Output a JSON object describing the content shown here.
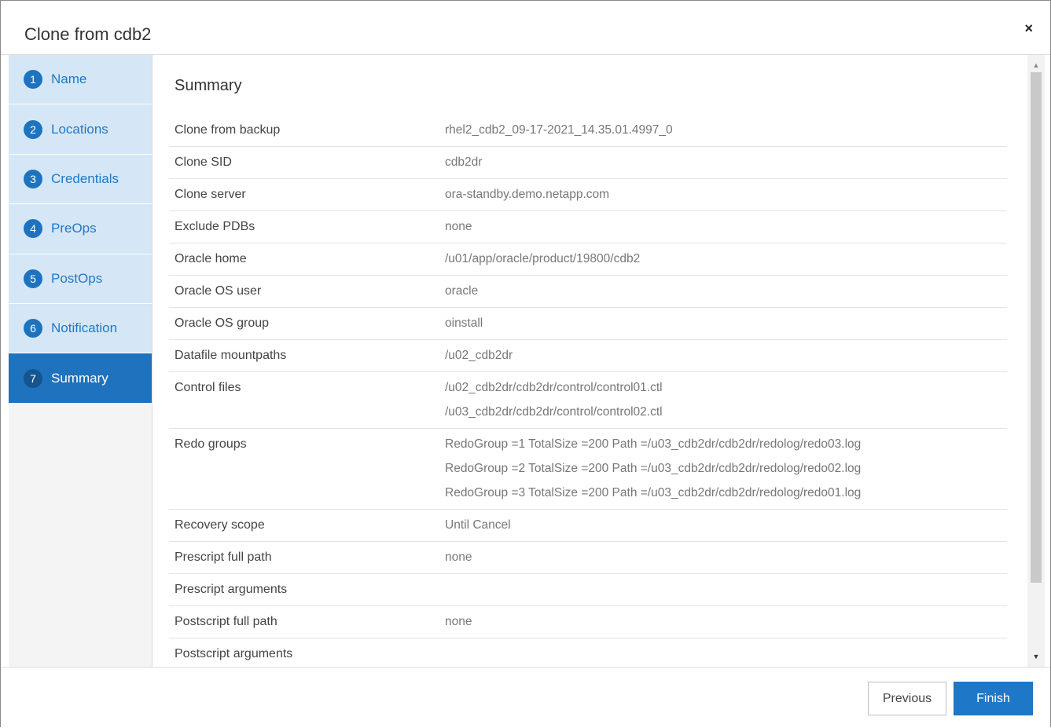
{
  "dialog": {
    "title": "Clone from cdb2",
    "close_label": "×"
  },
  "sidebar": {
    "items": [
      {
        "number": "1",
        "label": "Name"
      },
      {
        "number": "2",
        "label": "Locations"
      },
      {
        "number": "3",
        "label": "Credentials"
      },
      {
        "number": "4",
        "label": "PreOps"
      },
      {
        "number": "5",
        "label": "PostOps"
      },
      {
        "number": "6",
        "label": "Notification"
      },
      {
        "number": "7",
        "label": "Summary"
      }
    ],
    "active_index": 6
  },
  "main": {
    "title": "Summary",
    "rows": [
      {
        "key": "Clone from backup",
        "values": [
          "rhel2_cdb2_09-17-2021_14.35.01.4997_0"
        ]
      },
      {
        "key": "Clone SID",
        "values": [
          "cdb2dr"
        ]
      },
      {
        "key": "Clone server",
        "values": [
          "ora-standby.demo.netapp.com"
        ]
      },
      {
        "key": "Exclude PDBs",
        "values": [
          "none"
        ]
      },
      {
        "key": "Oracle home",
        "values": [
          "/u01/app/oracle/product/19800/cdb2"
        ]
      },
      {
        "key": "Oracle OS user",
        "values": [
          "oracle"
        ]
      },
      {
        "key": "Oracle OS group",
        "values": [
          "oinstall"
        ]
      },
      {
        "key": "Datafile mountpaths",
        "values": [
          "/u02_cdb2dr"
        ]
      },
      {
        "key": "Control files",
        "values": [
          "/u02_cdb2dr/cdb2dr/control/control01.ctl",
          "/u03_cdb2dr/cdb2dr/control/control02.ctl"
        ]
      },
      {
        "key": "Redo groups",
        "values": [
          "RedoGroup =1 TotalSize =200 Path =/u03_cdb2dr/cdb2dr/redolog/redo03.log",
          "RedoGroup =2 TotalSize =200 Path =/u03_cdb2dr/cdb2dr/redolog/redo02.log",
          "RedoGroup =3 TotalSize =200 Path =/u03_cdb2dr/cdb2dr/redolog/redo01.log"
        ]
      },
      {
        "key": "Recovery scope",
        "values": [
          "Until Cancel"
        ]
      },
      {
        "key": "Prescript full path",
        "values": [
          "none"
        ]
      },
      {
        "key": "Prescript arguments",
        "values": [
          ""
        ]
      },
      {
        "key": "Postscript full path",
        "values": [
          "none"
        ]
      },
      {
        "key": "Postscript arguments",
        "values": [
          ""
        ]
      }
    ]
  },
  "footer": {
    "previous_label": "Previous",
    "finish_label": "Finish"
  },
  "colors": {
    "accent": "#1f78c7",
    "step_inactive_bg": "#d5e7f6",
    "step_active_bg": "#1f72bd"
  },
  "icons": {
    "close": "close-icon",
    "scroll_up": "scroll-up-icon",
    "scroll_down": "scroll-down-icon"
  }
}
